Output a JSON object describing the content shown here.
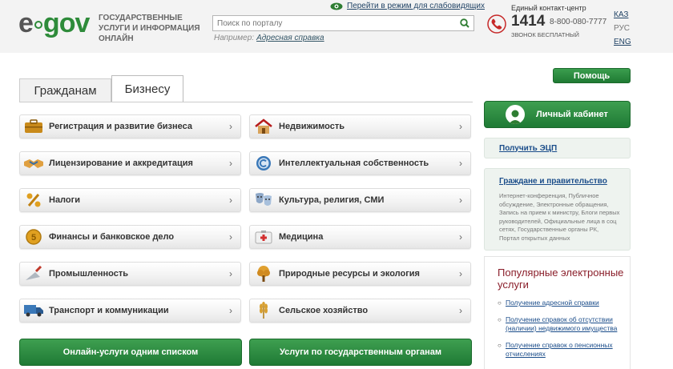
{
  "header": {
    "logo_e": "e",
    "logo_gov": "gov",
    "tagline": "ГОСУДАРСТВЕННЫЕ УСЛУГИ И ИНФОРМАЦИЯ ОНЛАЙН",
    "low_vision_link": "Перейти в режим для слабовидящих",
    "search_placeholder": "Поиск по порталу",
    "example_label": "Например:",
    "example_link": "Адресная справка",
    "contact_label": "Единый контакт-центр",
    "short_number": "1414",
    "long_number": "8-800-080-7777",
    "free_label": "ЗВОНОК БЕСПЛАТНЫЙ",
    "languages": [
      "КАЗ",
      "РУС",
      "ENG"
    ],
    "help_button": "Помощь"
  },
  "tabs": [
    "Гражданам",
    "Бизнесу"
  ],
  "categories": [
    {
      "label": "Регистрация и развитие бизнеса",
      "icon": "briefcase-icon"
    },
    {
      "label": "Недвижимость",
      "icon": "house-icon"
    },
    {
      "label": "Лицензирование и аккредитация",
      "icon": "handshake-icon"
    },
    {
      "label": "Интеллектуальная собственность",
      "icon": "copyright-icon"
    },
    {
      "label": "Налоги",
      "icon": "percent-icon"
    },
    {
      "label": "Культура, религия, СМИ",
      "icon": "theater-masks-icon"
    },
    {
      "label": "Финансы и банковское дело",
      "icon": "coin-icon"
    },
    {
      "label": "Медицина",
      "icon": "first-aid-icon"
    },
    {
      "label": "Промышленность",
      "icon": "trowel-icon"
    },
    {
      "label": "Природные ресурсы и экология",
      "icon": "tree-icon"
    },
    {
      "label": "Транспорт и коммуникации",
      "icon": "truck-icon"
    },
    {
      "label": "Сельское хозяйство",
      "icon": "wheat-icon"
    }
  ],
  "bottom_buttons": [
    "Онлайн-услуги одним списком",
    "Услуги по государственным органам"
  ],
  "sidebar": {
    "cabinet_button": "Личный кабинет",
    "ecp_link": "Получить ЭЦП",
    "gov_title": "Граждане и правительство",
    "gov_desc": "Интернет-конференция, Публичное обсуждение, Электронные обращения, Запись на прием к министру, Блоги первых руководителей, Официальные лица в соц сетях, Государственные органы РК, Портал открытых данных",
    "popular_title": "Популярные электронные услуги",
    "popular_items": [
      "Получение адресной справки",
      "Получение справок об отсутствии (наличии) недвижимого имущества",
      "Получение справок о пенсионных отчислениях"
    ]
  },
  "colors": {
    "brand_green": "#2e8b3a",
    "link_blue": "#1b4d8a",
    "popular_title": "#8a1e2a"
  }
}
